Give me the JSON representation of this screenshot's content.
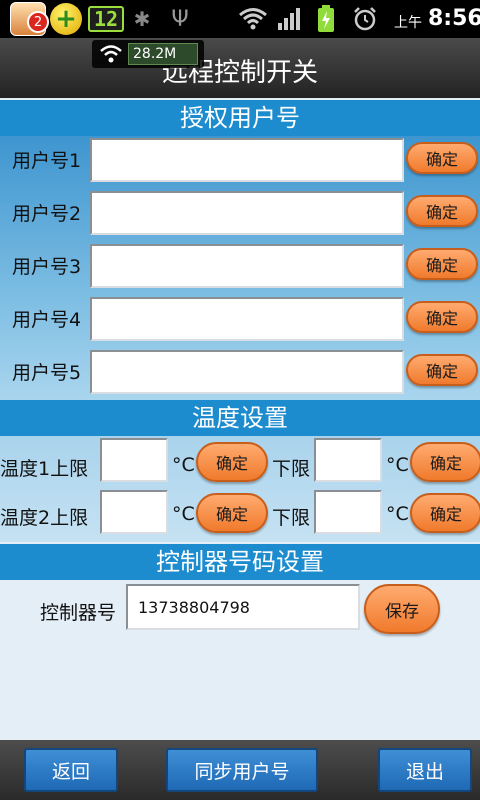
{
  "statusbar": {
    "badge_count": "2",
    "ampm": "上午",
    "time": "8:56",
    "net_speed": "28.2M"
  },
  "title": "远程控制开关",
  "users": {
    "header": "授权用户号",
    "confirm_label": "确定",
    "items": [
      {
        "label": "用户号1",
        "value": ""
      },
      {
        "label": "用户号2",
        "value": ""
      },
      {
        "label": "用户号3",
        "value": ""
      },
      {
        "label": "用户号4",
        "value": ""
      },
      {
        "label": "用户号5",
        "value": ""
      }
    ]
  },
  "temperature": {
    "header": "温度设置",
    "unit": "°C",
    "confirm_label": "确定",
    "lower_label": "下限",
    "rows": [
      {
        "label": "温度1上限",
        "upper": "",
        "lower": ""
      },
      {
        "label": "温度2上限",
        "upper": "",
        "lower": ""
      }
    ]
  },
  "controller": {
    "header": "控制器号码设置",
    "label": "控制器号",
    "number": "13738804798",
    "save_label": "保存"
  },
  "bottom": {
    "back": "返回",
    "sync": "同步用户号",
    "exit": "退出"
  },
  "colors": {
    "section_header": "#1d8ccf",
    "confirm_button": "#f07a2c",
    "bottom_button": "#1f69b5"
  }
}
